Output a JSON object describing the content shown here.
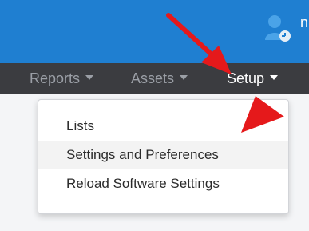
{
  "header": {
    "user_initial": "n"
  },
  "nav": {
    "items": [
      {
        "label": "Reports"
      },
      {
        "label": "Assets"
      },
      {
        "label": "Setup"
      }
    ]
  },
  "dropdown": {
    "items": [
      {
        "label": "Lists"
      },
      {
        "label": "Settings and Preferences"
      },
      {
        "label": "Reload Software Settings"
      }
    ]
  },
  "colors": {
    "header_blue": "#1f7fd1",
    "nav_dark": "#3b3c40",
    "annotation_red": "#e5191b"
  },
  "icons": {
    "user": "user-icon",
    "annotation": "arrow-icon"
  }
}
